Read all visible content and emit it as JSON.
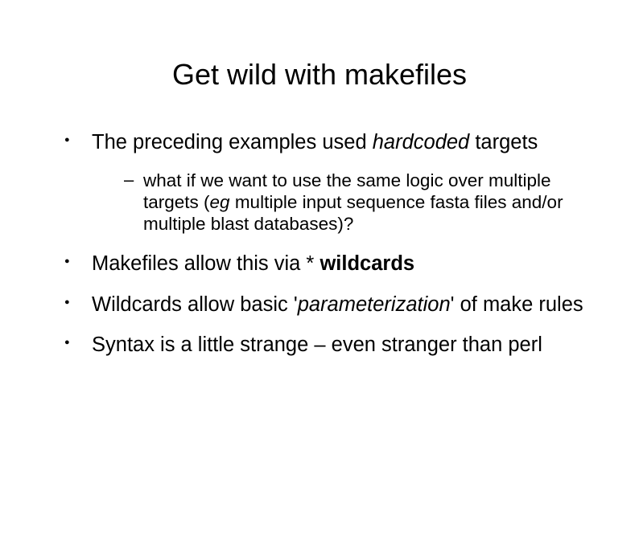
{
  "title": "Get wild with makefiles",
  "bullets": {
    "b1_pre": "The preceding examples used ",
    "b1_em": "hardcoded",
    "b1_post": " targets",
    "b1_sub_pre": "what if we want to use the same logic over multiple targets (",
    "b1_sub_em": "eg",
    "b1_sub_post": " multiple input sequence fasta files and/or multiple blast databases)?",
    "b2_pre": "Makefiles allow this via * ",
    "b2_bold": "wildcards",
    "b3_pre": "Wildcards allow basic '",
    "b3_em": "parameterization",
    "b3_post": "' of make rules",
    "b4": "Syntax is a little strange – even stranger than perl"
  }
}
